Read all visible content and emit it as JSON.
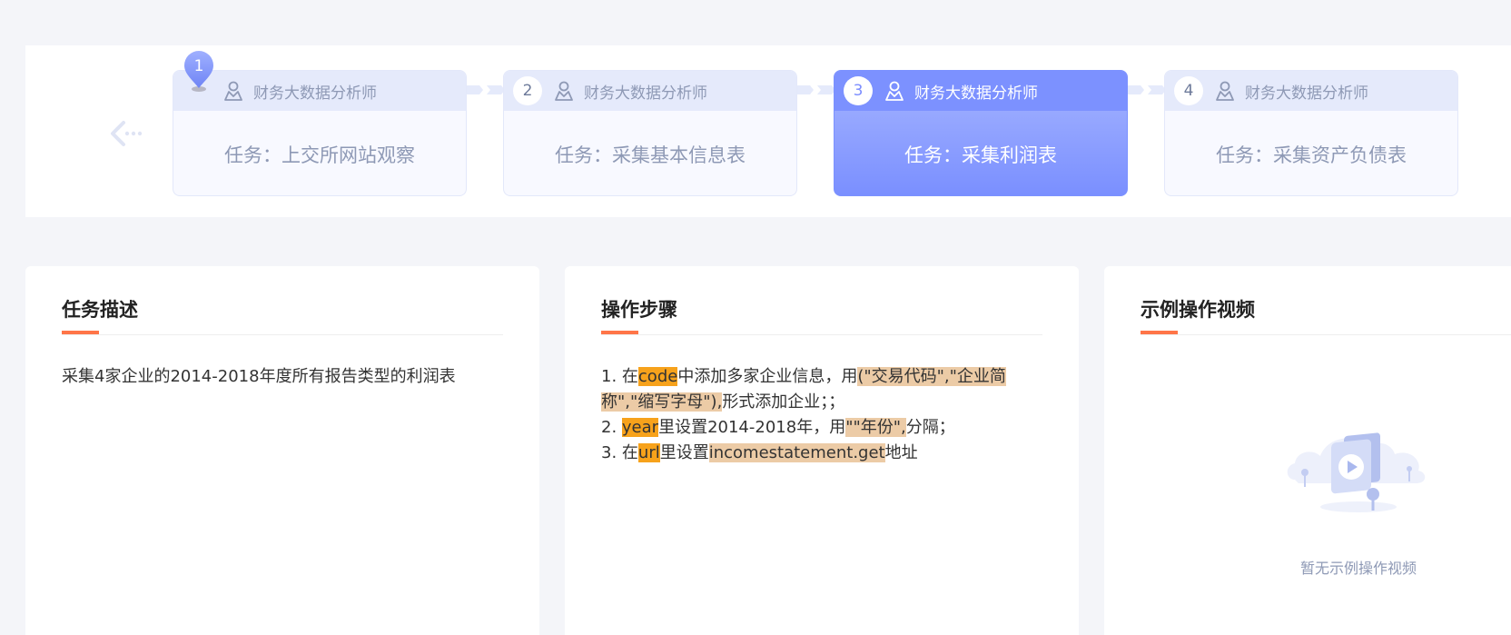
{
  "stepper": {
    "steps": [
      {
        "num": "1",
        "role": "财务大数据分析师",
        "task": "任务：上交所网站观察"
      },
      {
        "num": "2",
        "role": "财务大数据分析师",
        "task": "任务：采集基本信息表"
      },
      {
        "num": "3",
        "role": "财务大数据分析师",
        "task": "任务：采集利润表"
      },
      {
        "num": "4",
        "role": "财务大数据分析师",
        "task": "任务：采集资产负债表"
      }
    ],
    "active_index": 2
  },
  "task_card": {
    "title": "任务描述",
    "text": "采集4家企业的2014-2018年度所有报告类型的利润表"
  },
  "steps_card": {
    "title": "操作步骤",
    "line1": {
      "prefix": "1. 在",
      "key": "code",
      "mid": "中添加多家企业信息，用",
      "val": "(\"交易代码\",\"企业简称\",\"缩写字母\"),",
      "suffix": "形式添加企业；；"
    },
    "line2": {
      "prefix": "2. ",
      "key": "year",
      "mid": "里设置2014-2018年，用",
      "val": "\"\"年份\",",
      "suffix": "分隔；"
    },
    "line3": {
      "prefix": "3. 在",
      "key": "url",
      "mid": "里设置",
      "val": "incomestatement.get",
      "suffix": "地址"
    }
  },
  "video_card": {
    "title": "示例操作视频",
    "empty_text": "暂无示例操作视频"
  },
  "colors": {
    "accent_orange": "#ff7548",
    "active_blue": "#7c91ff",
    "highlight_key": "#f7a21b",
    "highlight_value": "#eccba6"
  }
}
